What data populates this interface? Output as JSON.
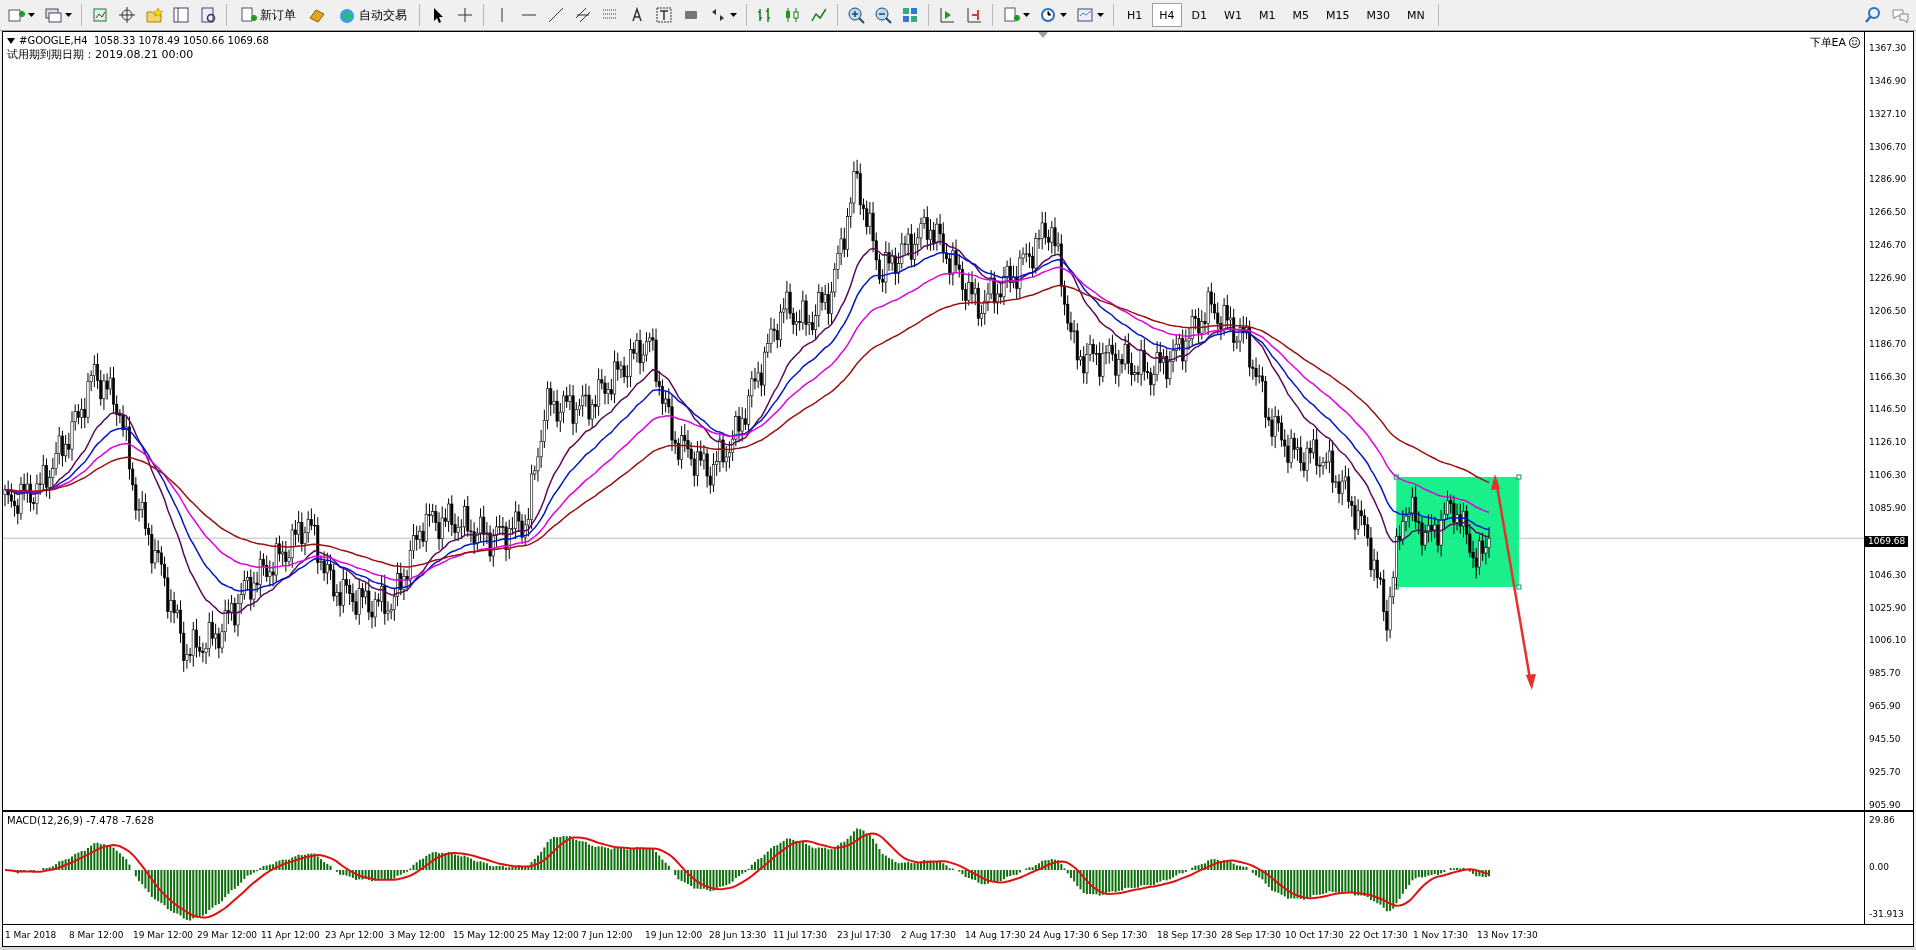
{
  "toolbar": {
    "new_order_button": {
      "label": "新订单"
    },
    "auto_trading_button": {
      "label": "自动交易"
    },
    "timeframes": [
      {
        "label": "H1",
        "selected": false
      },
      {
        "label": "H4",
        "selected": true
      },
      {
        "label": "D1",
        "selected": false
      },
      {
        "label": "W1",
        "selected": false
      },
      {
        "label": "M1",
        "selected": false
      },
      {
        "label": "M5",
        "selected": false
      },
      {
        "label": "M15",
        "selected": false
      },
      {
        "label": "M30",
        "selected": false
      },
      {
        "label": "MN",
        "selected": false
      }
    ]
  },
  "chart": {
    "symbol_info": "#GOOGLE,H4  1058.33 1078.49 1050.66 1069.68",
    "trial_note": "试用期到期日期：2019.08.21 00:00",
    "ea_label": "下单EA",
    "price_axis": [
      "1367.30",
      "1346.90",
      "1327.10",
      "1306.70",
      "1286.90",
      "1266.50",
      "1246.70",
      "1226.90",
      "1206.50",
      "1186.70",
      "1166.30",
      "1146.50",
      "1126.10",
      "1106.30",
      "1085.90",
      "1046.30",
      "1025.90",
      "1006.10",
      "985.70",
      "965.90",
      "945.50",
      "925.70",
      "905.90"
    ],
    "current_price": "1069.68"
  },
  "macd": {
    "label": "MACD(12,26,9) -7.478 -7.628",
    "axis": [
      "29.86",
      "0.00",
      "-31.913"
    ]
  },
  "time_axis": [
    "1 Mar 2018",
    "8 Mar 12:00",
    "19 Mar 12:00",
    "29 Mar 12:00",
    "11 Apr 12:00",
    "23 Apr 12:00",
    "3 May 12:00",
    "15 May 12:00",
    "25 May 12:00",
    "7 Jun 12:00",
    "19 Jun 12:00",
    "28 Jun 13:30",
    "11 Jul 17:30",
    "23 Jul 17:30",
    "2 Aug 17:30",
    "14 Aug 17:30",
    "24 Aug 17:30",
    "6 Sep 17:30",
    "18 Sep 17:30",
    "28 Sep 17:30",
    "10 Oct 17:30",
    "22 Oct 17:30",
    "1 Nov 17:30",
    "13 Nov 17:30"
  ]
}
